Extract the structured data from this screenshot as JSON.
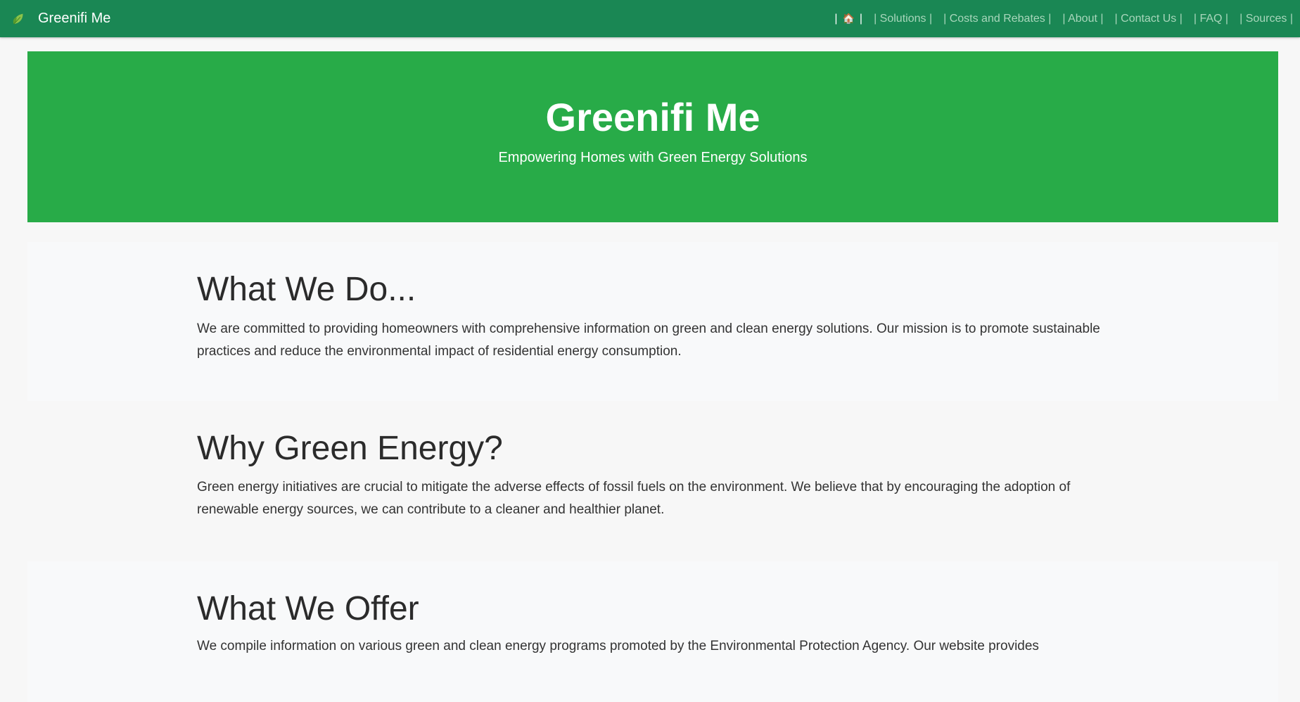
{
  "navbar": {
    "brand": "Greenifi Me",
    "brand_icon": "leaf-icon",
    "home_icon": "house-icon",
    "home_sep_left": "|",
    "home_sep_right": "|",
    "items": [
      {
        "label": "| Solutions |"
      },
      {
        "label": "| Costs and Rebates |"
      },
      {
        "label": "| About |"
      },
      {
        "label": "| Contact Us |"
      },
      {
        "label": "| FAQ |"
      },
      {
        "label": "| Sources |"
      }
    ]
  },
  "hero": {
    "title": "Greenifi Me",
    "subtitle": "Empowering Homes with Green Energy Solutions"
  },
  "sections": [
    {
      "heading": "What We Do...",
      "body": "We are committed to providing homeowners with comprehensive information on green and clean energy solutions. Our mission is to promote sustainable practices and reduce the environmental impact of residential energy consumption."
    },
    {
      "heading": "Why Green Energy?",
      "body": "Green energy initiatives are crucial to mitigate the adverse effects of fossil fuels on the environment. We believe that by encouraging the adoption of renewable energy sources, we can contribute to a cleaner and healthier planet."
    },
    {
      "heading": "What We Offer",
      "body": "We compile information on various green and clean energy programs promoted by the Environmental Protection Agency. Our website provides"
    }
  ],
  "colors": {
    "navbar": "#1a8754",
    "hero": "#28ab48",
    "nav_link": "#a8d6bb"
  }
}
